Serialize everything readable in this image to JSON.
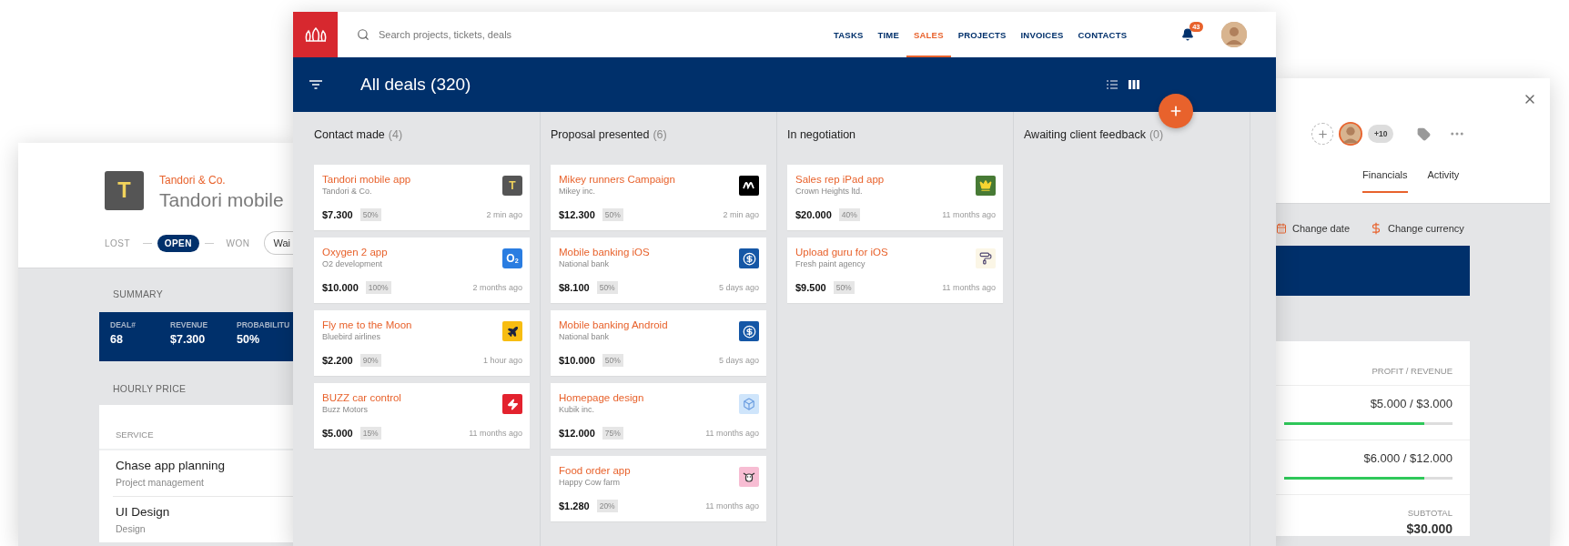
{
  "detail_window": {
    "logo": {
      "kind": "letter_gold",
      "text": "T",
      "color": "#555555"
    },
    "company": "Tandori & Co.",
    "title": "Tandori mobile",
    "stages": [
      {
        "label": "LOST",
        "selected": false
      },
      {
        "label": "OPEN",
        "selected": true
      },
      {
        "label": "WON",
        "selected": false
      }
    ],
    "status": "Wai",
    "summary_heading": "SUMMARY",
    "summary": [
      {
        "label": "DEAL#",
        "value": "68"
      },
      {
        "label": "REVENUE",
        "value": "$7.300"
      },
      {
        "label": "PROBABILITU",
        "value": "50%"
      }
    ],
    "hourly_heading": "HOURLY PRICE",
    "service_heading": "SERVICE",
    "services": [
      {
        "name": "Chase app planning",
        "category": "Project management"
      },
      {
        "name": "UI Design",
        "category": "Design"
      }
    ]
  },
  "main_window": {
    "search": {
      "placeholder": "Search projects, tickets, deals"
    },
    "nav": [
      {
        "label": "TASKS",
        "selected": false
      },
      {
        "label": "TIME",
        "selected": false
      },
      {
        "label": "SALES",
        "selected": true
      },
      {
        "label": "PROJECTS",
        "selected": false
      },
      {
        "label": "INVOICES",
        "selected": false
      },
      {
        "label": "CONTACTS",
        "selected": false
      }
    ],
    "notifications": "43",
    "title": "All deals (320)",
    "views": [
      {
        "kind": "list",
        "selected": false
      },
      {
        "kind": "board",
        "selected": true
      }
    ],
    "columns": [
      {
        "title": "Contact made",
        "count": "(4)",
        "cards": [
          {
            "title": "Tandori mobile app",
            "company": "Tandori & Co.",
            "amount": "$7.300",
            "probability": "50%",
            "time": "2 min ago",
            "logo": {
              "kind": "letter_gold",
              "text": "T",
              "color": "#555555"
            }
          },
          {
            "title": "Oxygen 2 app",
            "company": "O2 development",
            "amount": "$10.000",
            "probability": "100%",
            "time": "2 months ago",
            "logo": {
              "kind": "letter_white",
              "text": "O$_{2}$",
              "color": "#2a7de1"
            }
          },
          {
            "title": "Fly me to the Moon",
            "company": "Bluebird airlines",
            "amount": "$2.200",
            "probability": "90%",
            "time": "1 hour ago",
            "logo": {
              "kind": "plane",
              "color": "#f7bd12"
            }
          },
          {
            "title": "BUZZ car control",
            "company": "Buzz Motors",
            "amount": "$5.000",
            "probability": "15%",
            "time": "11 months ago",
            "logo": {
              "kind": "bolt",
              "color": "#e3222e"
            }
          }
        ]
      },
      {
        "title": "Proposal presented",
        "count": "(6)",
        "cards": [
          {
            "title": "Mikey runners Campaign",
            "company": "Mikey inc.",
            "amount": "$12.300",
            "probability": "50%",
            "time": "2 min ago",
            "logo": {
              "kind": "wave",
              "color": "#000000"
            }
          },
          {
            "title": "Mobile banking iOS",
            "company": "National bank",
            "amount": "$8.100",
            "probability": "50%",
            "time": "5 days ago",
            "logo": {
              "kind": "dollar",
              "color": "#1557a6"
            }
          },
          {
            "title": "Mobile banking Android",
            "company": "National bank",
            "amount": "$10.000",
            "probability": "50%",
            "time": "5 days ago",
            "logo": {
              "kind": "dollar",
              "color": "#1557a6"
            }
          },
          {
            "title": "Homepage design",
            "company": "Kubik inc.",
            "amount": "$12.000",
            "probability": "75%",
            "time": "11 months ago",
            "logo": {
              "kind": "cube",
              "color": "#cfe5fb"
            }
          },
          {
            "title": "Food order app",
            "company": "Happy Cow farm",
            "amount": "$1.280",
            "probability": "20%",
            "time": "11 months ago",
            "logo": {
              "kind": "cow",
              "color": "#f7bdd3"
            }
          }
        ]
      },
      {
        "title": "In negotiation",
        "cards": [
          {
            "title": "Sales rep iPad app",
            "company": "Crown Heights ltd.",
            "amount": "$20.000",
            "probability": "40%",
            "time": "11 months ago",
            "logo": {
              "kind": "crown",
              "color": "#477a35"
            }
          },
          {
            "title": "Upload guru for iOS",
            "company": "Fresh paint agency",
            "amount": "$9.500",
            "probability": "50%",
            "time": "11 months ago",
            "logo": {
              "kind": "roller",
              "color": "#fbf6e6"
            }
          }
        ]
      },
      {
        "title": "Awaiting client feedback",
        "count": "(0)"
      }
    ]
  },
  "side_window": {
    "members_more": "+10",
    "tabs": [
      {
        "label": "Financials",
        "selected": true
      },
      {
        "label": "Activity",
        "selected": false
      }
    ],
    "actions": [
      {
        "kind": "date",
        "label": "Change date"
      },
      {
        "kind": "currency",
        "label": "Change currency"
      }
    ],
    "column_heading": "PROFIT / REVENUE",
    "rows": [
      {
        "value": "$5.000 / $3.000",
        "level": 0.83
      },
      {
        "value": "$6.000 / $12.000",
        "level": 0.83
      }
    ],
    "subtotal_label": "SUBTOTAL",
    "subtotal": "$30.000"
  }
}
